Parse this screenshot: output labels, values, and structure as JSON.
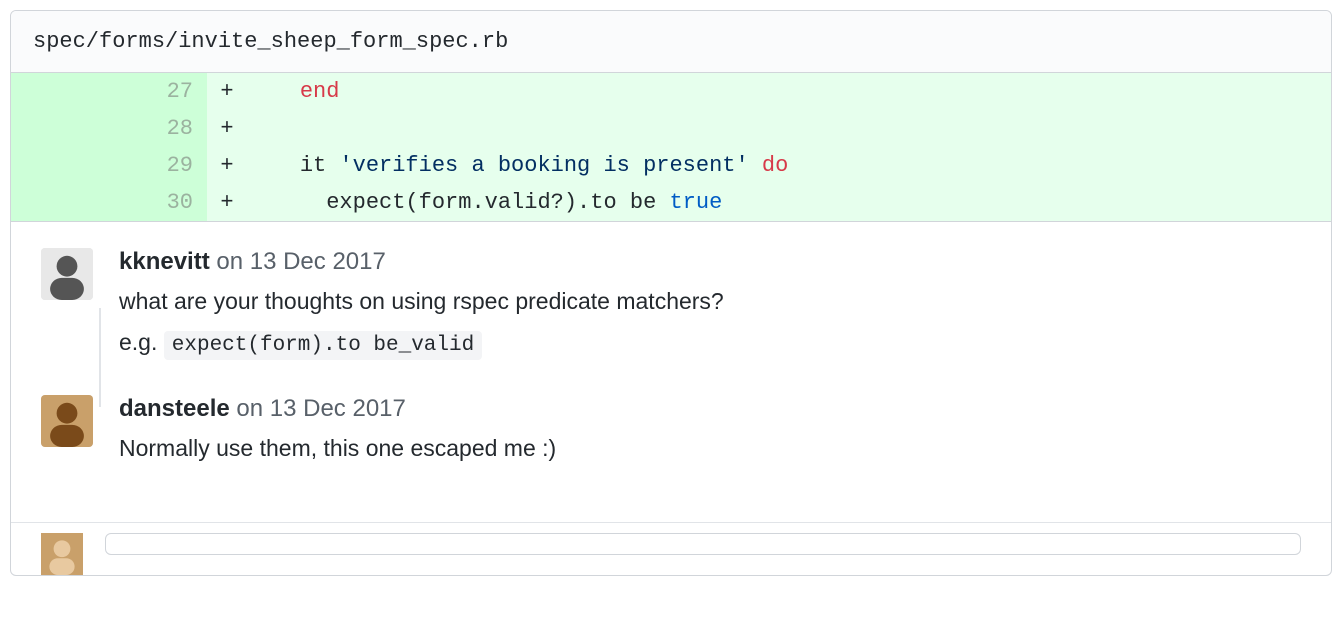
{
  "file": {
    "path": "spec/forms/invite_sheep_form_spec.rb"
  },
  "diff": {
    "lines": [
      {
        "old_num": "",
        "new_num": "27",
        "sign": "+",
        "indent": "    ",
        "tokens": [
          {
            "cls": "kw-end",
            "t": "end"
          }
        ]
      },
      {
        "old_num": "",
        "new_num": "28",
        "sign": "+",
        "indent": "",
        "tokens": []
      },
      {
        "old_num": "",
        "new_num": "29",
        "sign": "+",
        "indent": "    ",
        "tokens": [
          {
            "cls": "",
            "t": "it "
          },
          {
            "cls": "kw-str",
            "t": "'verifies a booking is present'"
          },
          {
            "cls": "",
            "t": " "
          },
          {
            "cls": "kw-do",
            "t": "do"
          }
        ]
      },
      {
        "old_num": "",
        "new_num": "30",
        "sign": "+",
        "indent": "      ",
        "tokens": [
          {
            "cls": "",
            "t": "expect(form.valid?).to be "
          },
          {
            "cls": "kw-true",
            "t": "true"
          }
        ]
      }
    ]
  },
  "comments": [
    {
      "author": "kknevitt",
      "date": "on 13 Dec 2017",
      "body_plain": "what are your thoughts on using rspec predicate matchers?",
      "body_extra_prefix": "e.g. ",
      "body_extra_code": "expect(form).to be_valid",
      "avatar_colors": {
        "bg": "#e8e8e8",
        "fg": "#555"
      }
    },
    {
      "author": "dansteele",
      "date": "on 13 Dec 2017",
      "body_plain": "Normally use them, this one escaped me :)",
      "body_extra_prefix": "",
      "body_extra_code": "",
      "avatar_colors": {
        "bg": "#c9a06a",
        "fg": "#7a4a1a"
      }
    }
  ]
}
